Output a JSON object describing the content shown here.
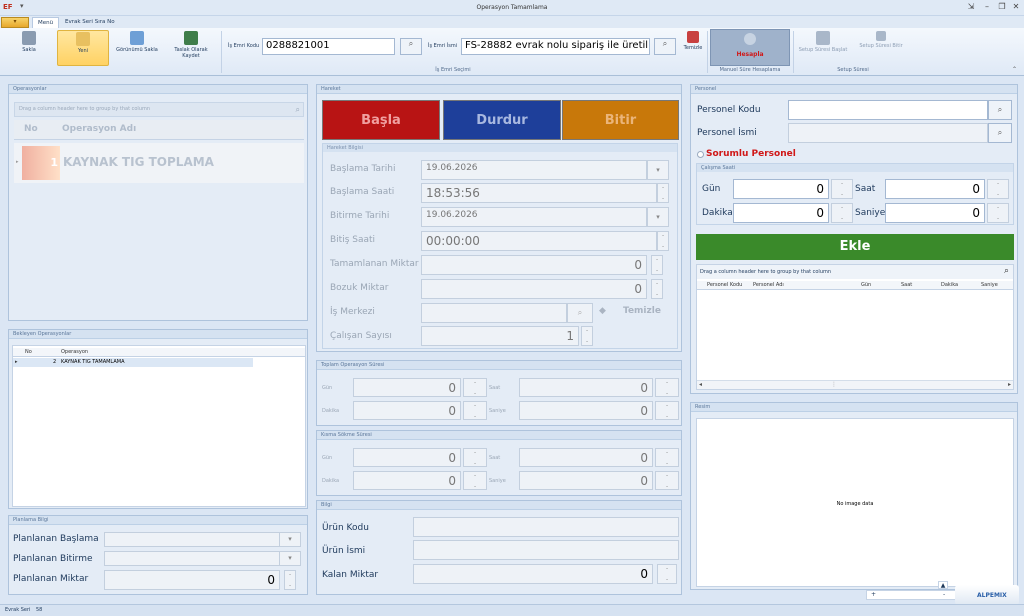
{
  "window": {
    "title": "Operasyon Tamamlama",
    "logo": "EF",
    "qat": "▾"
  },
  "tabs": {
    "file": "",
    "menu": "Menü",
    "evrak": "Evrak Seri Sıra No"
  },
  "ribbon": {
    "sakla": "Sakla",
    "yeni": "Yeni",
    "gorunum": "Görünümü Sakla",
    "taslak": "Taslak Olarak Kaydet",
    "is_emri_kodu_label": "İş Emri Kodu",
    "is_emri_kodu_value": "0288821001",
    "is_emri_ismi_label": "İş Emri İsmi",
    "is_emri_ismi_value": "FS-28882 evrak nolu sipariş ile üretil...",
    "is_emri_secimi": "İş Emri Seçimi",
    "temizle": "Temizle",
    "hesapla": "Hesapla",
    "manuel_sure": "Manuel Süre Hesaplama",
    "setup_baslat": "Setup Süresi Başlat",
    "setup_bitir": "Setup Süresi Bitir",
    "setup_suresi": "Setup Süresi"
  },
  "operasyonlar": {
    "title": "Operasyonlar",
    "group_hint": "Drag a column header here to group by that column",
    "col_no": "No",
    "col_ad": "Operasyon Adı",
    "row_no": "1",
    "row_ad": "KAYNAK TIG TOPLAMA"
  },
  "bekleyen": {
    "title": "Bekleyen Operasyonlar",
    "col_no": "No",
    "col_op": "Operasyon",
    "row_no": "2",
    "row_op": "KAYNAK TIG TAMAMLAMA"
  },
  "planlama": {
    "title": "Planlama Bilgi",
    "baslama": "Planlanan Başlama",
    "bitirme": "Planlanan Bitirme",
    "miktar": "Planlanan Miktar",
    "miktar_value": "0"
  },
  "hareket": {
    "title": "Hareket",
    "basla": "Başla",
    "durdur": "Durdur",
    "bitir": "Bitir",
    "basla_color": "#b81414",
    "durdur_color": "#1e3f9a",
    "bitir_color": "#c8780a",
    "bilgi_title": "Hareket Bilgisi",
    "baslama_tarihi": "Başlama Tarihi",
    "baslama_tarihi_value": "19.06.2026",
    "baslama_saati": "Başlama Saati",
    "baslama_saati_value": "18:53:56",
    "bitirme_tarihi": "Bitirme Tarihi",
    "bitirme_tarihi_value": "19.06.2026",
    "bitis_saati": "Bitiş Saati",
    "bitis_saati_value": "00:00:00",
    "tamamlanan": "Tamamlanan Miktar",
    "tamamlanan_value": "0",
    "bozuk": "Bozuk Miktar",
    "bozuk_value": "0",
    "is_merkezi": "İş Merkezi",
    "temizle": "Temizle",
    "calisan": "Çalışan Sayısı",
    "calisan_value": "1"
  },
  "toplam": {
    "title": "Toplam Operasyon Süresi",
    "gun": "Gün",
    "saat": "Saat",
    "dakika": "Dakika",
    "saniye": "Saniye",
    "v_gun": "0",
    "v_saat": "0",
    "v_dakika": "0",
    "v_saniye": "0"
  },
  "kisma": {
    "title": "Kısma Sökme Süresi",
    "gun": "Gün",
    "saat": "Saat",
    "dakika": "Dakika",
    "saniye": "Saniye",
    "v_gun": "0",
    "v_saat": "0",
    "v_dakika": "0",
    "v_saniye": "0"
  },
  "bilgi": {
    "title": "Bilgi",
    "urun_kodu": "Ürün Kodu",
    "urun_ismi": "Ürün İsmi",
    "kalan": "Kalan Miktar",
    "kalan_value": "0"
  },
  "personel": {
    "title": "Personel",
    "kodu": "Personel Kodu",
    "ismi": "Personel İsmi",
    "sorumlu": "Sorumlu Personel",
    "calisma": "Çalışma Saati",
    "gun": "Gün",
    "saat": "Saat",
    "dakika": "Dakika",
    "saniye": "Saniye",
    "v_gun": "0",
    "v_saat": "0",
    "v_dakika": "0",
    "v_saniye": "0",
    "ekle": "Ekle",
    "ekle_color": "#3a8a2a",
    "group_hint": "Drag a column header here to group by that column",
    "cols": [
      "Personel Kodu",
      "Personel Adı",
      "Gün",
      "Saat",
      "Dakika",
      "Saniye"
    ]
  },
  "resim": {
    "title": "Resim",
    "no_image": "No image data"
  },
  "status": {
    "label": "Evrak Seri",
    "value": "58",
    "brand": "ALPEMIX"
  }
}
